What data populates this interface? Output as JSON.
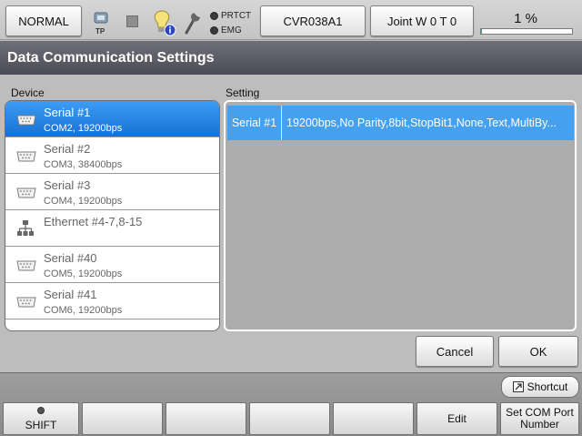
{
  "topbar": {
    "mode_label": "NORMAL",
    "tp_label": "TP",
    "prtct_label": "PRTCT",
    "emg_label": "EMG",
    "program_label": "CVR038A1",
    "joint_label": "Joint  W 0 T 0",
    "progress_text": "1 %",
    "progress_value": 0.01
  },
  "title": "Data Communication Settings",
  "device_section_label": "Device",
  "setting_section_label": "Setting",
  "devices": [
    {
      "name": "Serial #1",
      "sub": "COM2, 19200bps",
      "icon": "serial-port-icon",
      "selected": true
    },
    {
      "name": "Serial #2",
      "sub": "COM3, 38400bps",
      "icon": "serial-port-icon",
      "selected": false
    },
    {
      "name": "Serial #3",
      "sub": "COM4, 19200bps",
      "icon": "serial-port-icon",
      "selected": false
    },
    {
      "name": "Ethernet #4-7,8-15",
      "sub": "",
      "icon": "network-icon",
      "selected": false
    },
    {
      "name": "Serial #40",
      "sub": "COM5, 19200bps",
      "icon": "serial-port-icon",
      "selected": false
    },
    {
      "name": "Serial #41",
      "sub": "COM6, 19200bps",
      "icon": "serial-port-icon",
      "selected": false
    }
  ],
  "setting_row": {
    "key": "Serial #1",
    "value": "19200bps,No Parity,8bit,StopBit1,None,Text,MultiBy..."
  },
  "dialog": {
    "cancel_label": "Cancel",
    "ok_label": "OK"
  },
  "bottombar": {
    "shortcut_label": "Shortcut",
    "shift_label": "SHIFT",
    "f2_label": "",
    "f3_label": "",
    "f4_label": "",
    "f5_label": "",
    "edit_label": "Edit",
    "set_com_line1": "Set COM Port",
    "set_com_line2": "Number"
  },
  "colors": {
    "selection_blue": "#1671d4",
    "setting_row_blue": "#46a0f0",
    "title_bar": "#55555f",
    "bulb_yellow": "#f5e27a",
    "info_badge": "#2a46c8"
  }
}
